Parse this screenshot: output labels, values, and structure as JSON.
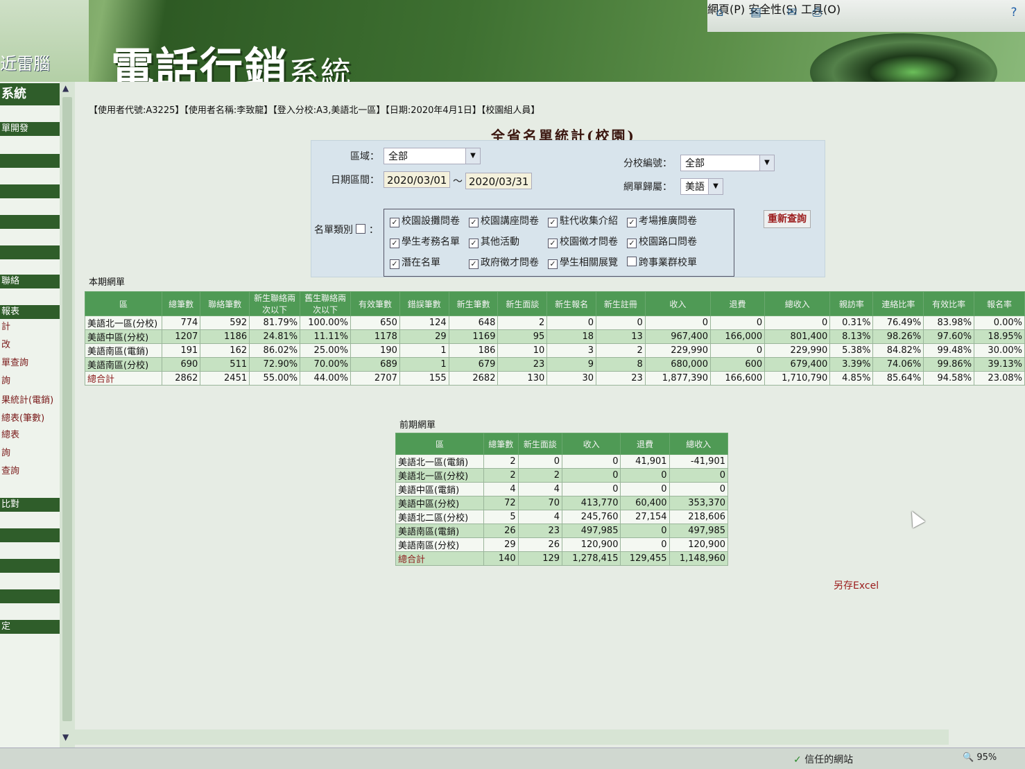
{
  "browser": {
    "menu": [
      "網頁(P)",
      "安全性(S)",
      "工具(O)"
    ],
    "icons": [
      "home-icon",
      "feed-icon",
      "mail-icon",
      "print-icon",
      "help-icon"
    ]
  },
  "banner": {
    "title_bold": "電話行銷",
    "title_light": "系統",
    "left_brand": "近雷腦"
  },
  "sidebar": {
    "items": [
      "系統",
      "單開發",
      "聯絡",
      "報表",
      "計",
      "改",
      "單查詢",
      "詢",
      "果統計(電銷)",
      "總表(筆數)",
      "總表",
      "詢",
      "查詢",
      "比對",
      "定"
    ]
  },
  "userinfo": "【使用者代號:A3225】【使用者名稱:李致龍】【登入分校:A3,美語北一區】【日期:2020年4月1日】【校園組人員】",
  "page_title": "全省名單統計(校園)",
  "filter": {
    "region_label": "區域：",
    "region_value": "全部",
    "branch_label": "分校編號：",
    "branch_value": "全部",
    "date_label": "日期區間：",
    "date_from": "2020/03/01",
    "date_sep": "～",
    "date_to": "2020/03/31",
    "listgroup_label": "網單歸屬：",
    "listgroup_value": "美語",
    "category_label": "名單類別",
    "category_colon": "：",
    "categories": [
      {
        "label": "校園設攤問卷",
        "checked": true
      },
      {
        "label": "校園講座問卷",
        "checked": true
      },
      {
        "label": "駐代收集介紹",
        "checked": true
      },
      {
        "label": "考場推廣問卷",
        "checked": true
      },
      {
        "label": "學生考務名單",
        "checked": true
      },
      {
        "label": "其他活動",
        "checked": true
      },
      {
        "label": "校園徵才問卷",
        "checked": true
      },
      {
        "label": "校園路口問卷",
        "checked": true
      },
      {
        "label": "潛在名單",
        "checked": true
      },
      {
        "label": "政府徵才問卷",
        "checked": true
      },
      {
        "label": "學生相關展覽",
        "checked": true
      },
      {
        "label": "跨事業群校單",
        "checked": false
      }
    ],
    "requery_label": "重新查詢"
  },
  "current": {
    "label": "本期網單",
    "headers": [
      "區",
      "總筆數",
      "聯絡筆數",
      "新生聯絡兩次以下",
      "舊生聯絡兩次以下",
      "有效筆數",
      "錯誤筆數",
      "新生筆數",
      "新生面談",
      "新生報名",
      "新生註冊",
      "收入",
      "退費",
      "總收入",
      "親訪率",
      "連絡比率",
      "有效比率",
      "報名率"
    ],
    "rows": [
      [
        "美語北一區(分校)",
        "774",
        "592",
        "81.79%",
        "100.00%",
        "650",
        "124",
        "648",
        "2",
        "0",
        "0",
        "0",
        "0",
        "0",
        "0.31%",
        "76.49%",
        "83.98%",
        "0.00%"
      ],
      [
        "美語中區(分校)",
        "1207",
        "1186",
        "24.81%",
        "11.11%",
        "1178",
        "29",
        "1169",
        "95",
        "18",
        "13",
        "967,400",
        "166,000",
        "801,400",
        "8.13%",
        "98.26%",
        "97.60%",
        "18.95%"
      ],
      [
        "美語南區(電銷)",
        "191",
        "162",
        "86.02%",
        "25.00%",
        "190",
        "1",
        "186",
        "10",
        "3",
        "2",
        "229,990",
        "0",
        "229,990",
        "5.38%",
        "84.82%",
        "99.48%",
        "30.00%"
      ],
      [
        "美語南區(分校)",
        "690",
        "511",
        "72.90%",
        "70.00%",
        "689",
        "1",
        "679",
        "23",
        "9",
        "8",
        "680,000",
        "600",
        "679,400",
        "3.39%",
        "74.06%",
        "99.86%",
        "39.13%"
      ],
      [
        "總合計",
        "2862",
        "2451",
        "55.00%",
        "44.00%",
        "2707",
        "155",
        "2682",
        "130",
        "30",
        "23",
        "1,877,390",
        "166,600",
        "1,710,790",
        "4.85%",
        "85.64%",
        "94.58%",
        "23.08%"
      ]
    ]
  },
  "previous": {
    "label": "前期網單",
    "headers": [
      "區",
      "總筆數",
      "新生面談",
      "收入",
      "退費",
      "總收入"
    ],
    "rows": [
      [
        "美語北一區(電銷)",
        "2",
        "0",
        "0",
        "41,901",
        "-41,901"
      ],
      [
        "美語北一區(分校)",
        "2",
        "2",
        "0",
        "0",
        "0"
      ],
      [
        "美語中區(電銷)",
        "4",
        "4",
        "0",
        "0",
        "0"
      ],
      [
        "美語中區(分校)",
        "72",
        "70",
        "413,770",
        "60,400",
        "353,370"
      ],
      [
        "美語北二區(分校)",
        "5",
        "4",
        "245,760",
        "27,154",
        "218,606"
      ],
      [
        "美語南區(電銷)",
        "26",
        "23",
        "497,985",
        "0",
        "497,985"
      ],
      [
        "美語南區(分校)",
        "29",
        "26",
        "120,900",
        "0",
        "120,900"
      ],
      [
        "總合計",
        "140",
        "129",
        "1,278,415",
        "129,455",
        "1,148,960"
      ]
    ]
  },
  "save_excel": "另存Excel",
  "status": {
    "trusted": "信任的網站",
    "zoom": "95%"
  }
}
